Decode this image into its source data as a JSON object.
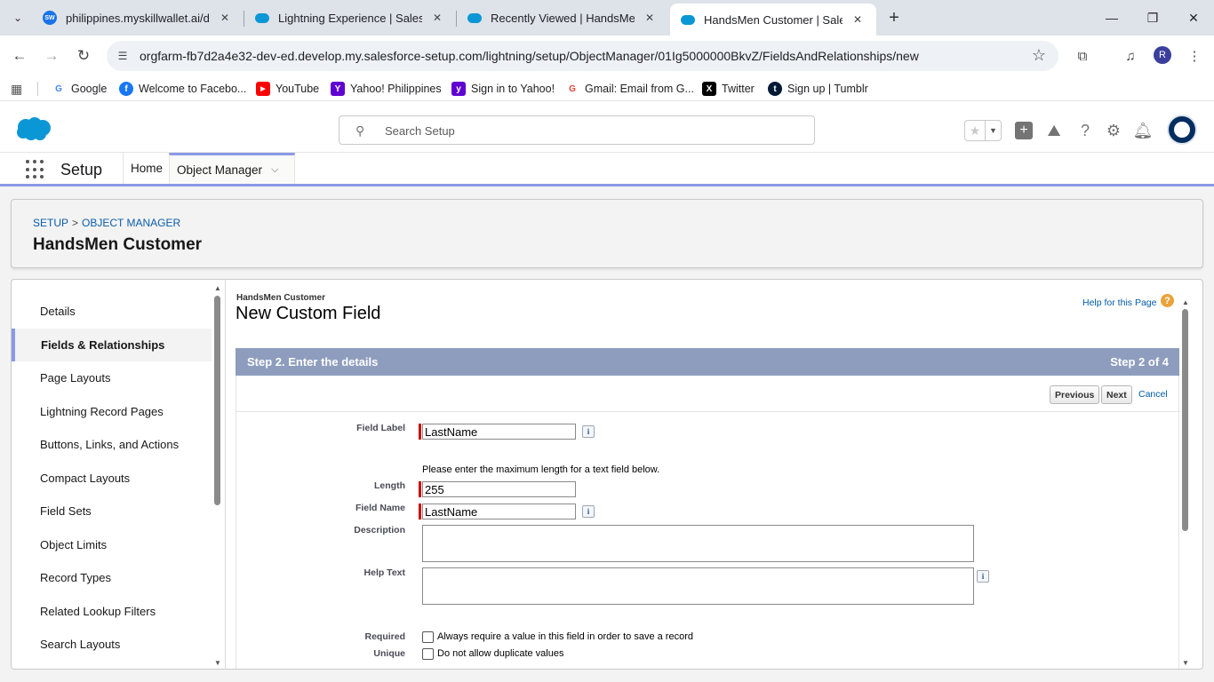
{
  "browser": {
    "tabs": [
      {
        "title": "philippines.myskillwallet.ai/dash"
      },
      {
        "title": "Lightning Experience | Salesforce"
      },
      {
        "title": "Recently Viewed | HandsMen Cu"
      },
      {
        "title": "HandsMen Customer | Salesforce"
      }
    ],
    "url": "orgfarm-fb7d2a4e32-dev-ed.develop.my.salesforce-setup.com/lightning/setup/ObjectManager/01Ig5000000BkvZ/FieldsAndRelationships/new",
    "profile_initial": "R",
    "bookmarks": [
      {
        "label": "Google"
      },
      {
        "label": "Welcome to Facebo..."
      },
      {
        "label": "YouTube"
      },
      {
        "label": "Yahoo! Philippines"
      },
      {
        "label": "Sign in to Yahoo!"
      },
      {
        "label": "Gmail: Email from G..."
      },
      {
        "label": "Twitter"
      },
      {
        "label": "Sign up | Tumblr"
      }
    ]
  },
  "header": {
    "search_placeholder": "Search Setup"
  },
  "nav": {
    "app_name": "Setup",
    "home": "Home",
    "object_manager": "Object Manager"
  },
  "breadcrumb": {
    "setup": "SETUP",
    "separator": ">",
    "object_manager": "OBJECT MANAGER"
  },
  "object_title": "HandsMen Customer",
  "sidebar": {
    "items": [
      {
        "label": "Details"
      },
      {
        "label": "Fields & Relationships"
      },
      {
        "label": "Page Layouts"
      },
      {
        "label": "Lightning Record Pages"
      },
      {
        "label": "Buttons, Links, and Actions"
      },
      {
        "label": "Compact Layouts"
      },
      {
        "label": "Field Sets"
      },
      {
        "label": "Object Limits"
      },
      {
        "label": "Record Types"
      },
      {
        "label": "Related Lookup Filters"
      },
      {
        "label": "Search Layouts"
      }
    ]
  },
  "main": {
    "object_label": "HandsMen Customer",
    "page_title": "New Custom Field",
    "help_link": "Help for this Page",
    "step_title": "Step 2. Enter the details",
    "step_count": "Step 2 of 4",
    "buttons": {
      "previous": "Previous",
      "next": "Next",
      "cancel": "Cancel"
    },
    "fields": {
      "field_label": {
        "label": "Field Label",
        "value": "LastName"
      },
      "length_hint": "Please enter the maximum length for a text field below.",
      "length": {
        "label": "Length",
        "value": "255"
      },
      "field_name": {
        "label": "Field Name",
        "value": "LastName"
      },
      "description": {
        "label": "Description",
        "value": ""
      },
      "help_text": {
        "label": "Help Text",
        "value": ""
      },
      "required": {
        "label": "Required",
        "text": "Always require a value in this field in order to save a record",
        "checked": false
      },
      "unique": {
        "label": "Unique",
        "text": "Do not allow duplicate values",
        "checked": false
      }
    }
  },
  "colors": {
    "accent": "#8a99e6",
    "step_bar": "#8e9dbe",
    "link": "#0b5cab",
    "required": "#cc0000"
  }
}
